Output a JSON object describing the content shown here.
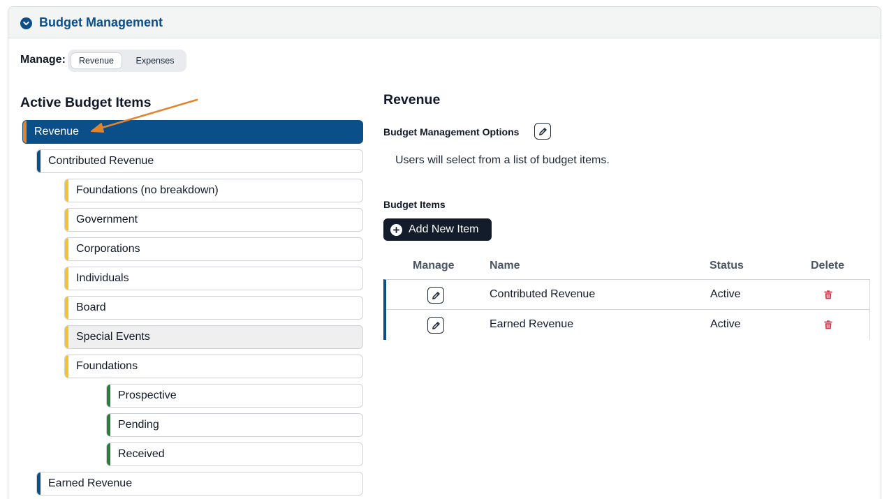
{
  "panel": {
    "title": "Budget Management"
  },
  "manage": {
    "label": "Manage:",
    "options": [
      "Revenue",
      "Expenses"
    ],
    "selected": "Revenue"
  },
  "left": {
    "heading": "Active Budget Items",
    "items": [
      {
        "label": "Revenue",
        "level": 0,
        "color": "orange",
        "state": "selected"
      },
      {
        "label": "Contributed Revenue",
        "level": 1,
        "color": "blue"
      },
      {
        "label": "Foundations (no breakdown)",
        "level": 2,
        "color": "yellow"
      },
      {
        "label": "Government",
        "level": 2,
        "color": "yellow"
      },
      {
        "label": "Corporations",
        "level": 2,
        "color": "yellow"
      },
      {
        "label": "Individuals",
        "level": 2,
        "color": "yellow"
      },
      {
        "label": "Board",
        "level": 2,
        "color": "yellow"
      },
      {
        "label": "Special Events",
        "level": 2,
        "color": "yellow",
        "state": "hover"
      },
      {
        "label": "Foundations",
        "level": 2,
        "color": "yellow"
      },
      {
        "label": "Prospective",
        "level": 3,
        "color": "green"
      },
      {
        "label": "Pending",
        "level": 3,
        "color": "green"
      },
      {
        "label": "Received",
        "level": 3,
        "color": "green"
      },
      {
        "label": "Earned Revenue",
        "level": 1,
        "color": "blue"
      }
    ]
  },
  "right": {
    "heading": "Revenue",
    "options_label": "Budget Management Options",
    "description": "Users will select from a list of budget items.",
    "items_label": "Budget Items",
    "add_button": "Add New Item",
    "table": {
      "headers": [
        "Manage",
        "Name",
        "Status",
        "Delete"
      ],
      "rows": [
        {
          "name": "Contributed Revenue",
          "status": "Active"
        },
        {
          "name": "Earned Revenue",
          "status": "Active"
        }
      ]
    }
  },
  "colors": {
    "primary": "#0b4f8a",
    "accent_orange": "#e2832d",
    "accent_yellow": "#f2c230",
    "accent_green": "#2a7d3d",
    "delete_red": "#d6334b",
    "dark_button": "#121c2a"
  },
  "icons": {
    "header": "chevron-down-circle-icon",
    "edit": "pencil-icon",
    "add": "plus-circle-icon",
    "delete": "trash-icon"
  }
}
